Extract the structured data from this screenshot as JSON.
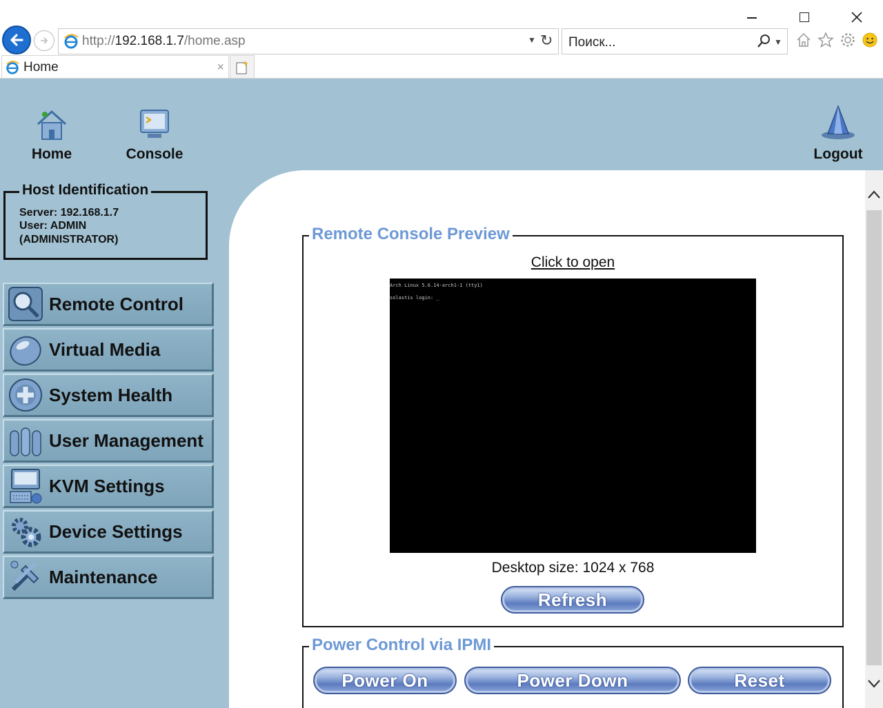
{
  "browser": {
    "address_prefix": "http://",
    "address_host": "192.168.1.7",
    "address_path": "/home.asp",
    "search_placeholder": "Поиск...",
    "tab_title": "Home",
    "tab_close": "×"
  },
  "topnav": {
    "home": "Home",
    "console": "Console",
    "logout": "Logout"
  },
  "host_identification": {
    "title": "Host Identification",
    "server": "Server: 192.168.1.7",
    "user": "User: ADMIN",
    "role": "(ADMINISTRATOR)"
  },
  "menu": [
    {
      "label": "Remote Control",
      "icon": "magnifier-icon"
    },
    {
      "label": "Virtual Media",
      "icon": "disk-icon"
    },
    {
      "label": "System Health",
      "icon": "health-cross-icon"
    },
    {
      "label": "User Management",
      "icon": "users-icon"
    },
    {
      "label": "KVM Settings",
      "icon": "kvm-icon"
    },
    {
      "label": "Device Settings",
      "icon": "gears-icon"
    },
    {
      "label": "Maintenance",
      "icon": "tools-icon"
    }
  ],
  "remote_console": {
    "legend": "Remote Console Preview",
    "click_to_open": "Click to open",
    "console_line1": "Arch Linux 5.6.14-arch1-1 (tty1)",
    "console_line2": "solastis login: _",
    "desktop_size": "Desktop size: 1024 x 768",
    "refresh_label": "Refresh"
  },
  "power_control": {
    "legend": "Power Control via IPMI",
    "power_on_label": "Power On",
    "power_down_label": "Power Down",
    "reset_label": "Reset"
  },
  "colors": {
    "page_bg": "#a2c2d3",
    "legend_text": "#6d99d6",
    "menu_button": "#8fb3c7",
    "browser_back": "#1e6fd1"
  }
}
